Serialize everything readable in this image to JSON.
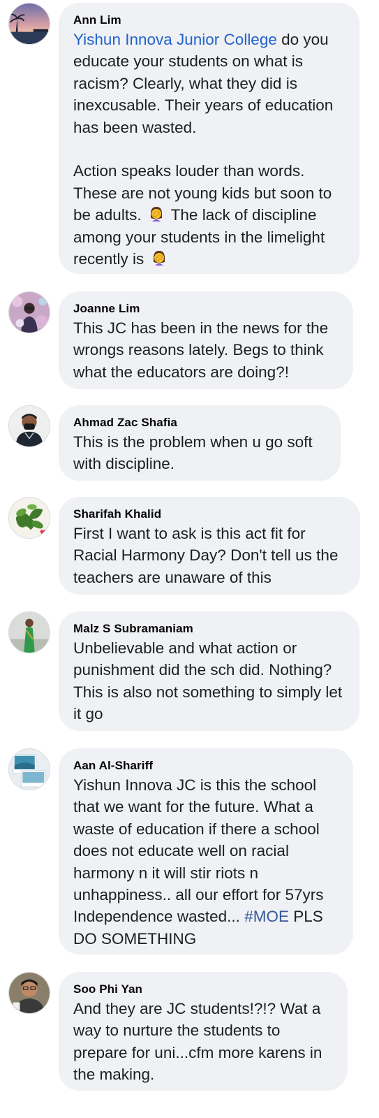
{
  "comments": [
    {
      "author": "Ann Lim",
      "tagged_page": "Yishun Innova Junior College",
      "text_1": " do you educate your students on what is racism? Clearly, what they did is inexcusable. Their years of education has been wasted.\n\nAction speaks louder than words. These are not young kids but soon to be adults. ",
      "text_2": " The lack of discipline among your students in the limelight recently is ",
      "emoji": "woman-facepalming-icon"
    },
    {
      "author": "Joanne Lim",
      "text": "This JC has been in the news for the wrongs reasons lately. Begs to think what the educators are doing?!"
    },
    {
      "author": "Ahmad Zac Shafia",
      "text": "This is the problem when u go soft with discipline."
    },
    {
      "author": "Sharifah Khalid",
      "text": "First I want to ask is this act fit for Racial Harmony Day? Don't tell us the teachers are unaware of this"
    },
    {
      "author": "Malz S Subramaniam",
      "text": "Unbelievable and what action or punishment did the sch did. Nothing?\n This is also not something to simply let it go"
    },
    {
      "author": "Aan Al-Shariff",
      "text_1": "Yishun Innova JC is this the school that we want for the future. What a waste of education if there a school does not educate well on racial harmony n it will stir riots n unhappiness.. all our effort for 57yrs Independence wasted... ",
      "hashtag": "#MOE",
      "text_2": " PLS DO SOMETHING"
    },
    {
      "author": "Soo Phi Yan",
      "text": "And they are JC students!?!? Wat a way to nurture the students to prepare for uni...cfm more karens in the making."
    }
  ],
  "colors": {
    "bubble_bg": "#eff1f4",
    "tag_link": "#2162c9",
    "hashtag": "#385898",
    "text": "#1c1e21"
  }
}
